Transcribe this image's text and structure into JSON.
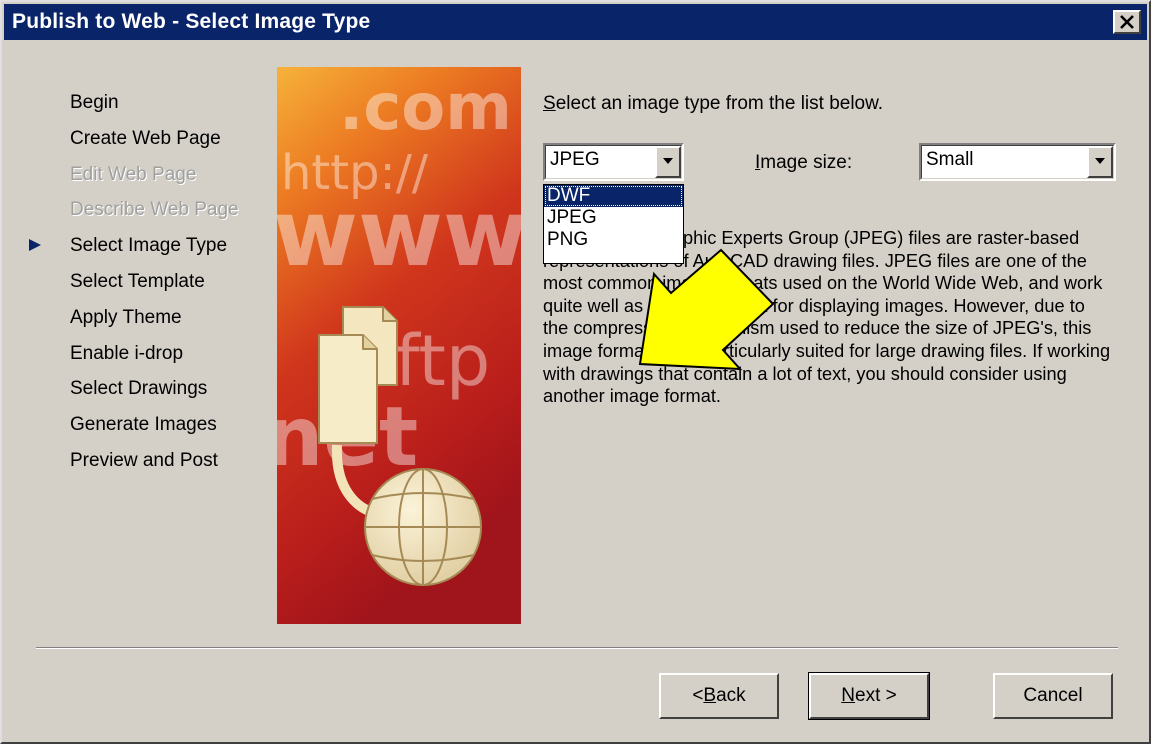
{
  "window": {
    "title": "Publish to Web - Select Image Type"
  },
  "steps": [
    {
      "label": "Begin",
      "state": "enabled"
    },
    {
      "label": "Create Web Page",
      "state": "enabled"
    },
    {
      "label": "Edit Web Page",
      "state": "disabled"
    },
    {
      "label": "Describe Web Page",
      "state": "disabled"
    },
    {
      "label": "Select Image Type",
      "state": "current"
    },
    {
      "label": "Select Template",
      "state": "enabled"
    },
    {
      "label": "Apply Theme",
      "state": "enabled"
    },
    {
      "label": "Enable i-drop",
      "state": "enabled"
    },
    {
      "label": "Select Drawings",
      "state": "enabled"
    },
    {
      "label": "Generate Images",
      "state": "enabled"
    },
    {
      "label": "Preview and Post",
      "state": "enabled"
    }
  ],
  "art": {
    "texts": [
      ".com",
      "http://",
      "www",
      "ftp",
      "net"
    ]
  },
  "instruction": {
    "mnemonic": "S",
    "rest": "elect an image type from the list below."
  },
  "image_type": {
    "value": "JPEG",
    "options": [
      "DWF",
      "JPEG",
      "PNG"
    ],
    "highlighted": "DWF"
  },
  "image_size": {
    "label_mnemonic": "I",
    "label_rest": "mage size:",
    "value": "Small"
  },
  "description_visible": "phic Experts Group (JPEG) files are raster-based representations of AutoCAD drawing files. JPEG files are one of the most common image formats used on the World Wide Web, and work quite well as a digital format for displaying images.  However, due to the compression mechanism used to reduce the size of JPEG's, this image format is not particularly suited for large drawing files.  If working with drawings that contain a lot of text, you should consider using another image format.",
  "buttons": {
    "back": {
      "prefix": "< ",
      "mnemonic": "B",
      "rest": "ack"
    },
    "next": {
      "mnemonic": "N",
      "rest": "ext >"
    },
    "cancel": {
      "label": "Cancel"
    }
  },
  "colors": {
    "title_bar": "#0a246a",
    "dialog_face": "#d4d0c8",
    "selection": "#0a246a",
    "pointer_arrow": "#ffff00",
    "step_marker": "#0a246a"
  },
  "icons": [
    "close-icon",
    "step-current-marker-icon",
    "dropdown-arrow-icon",
    "document-icon",
    "globe-icon",
    "pointer-arrow-icon"
  ]
}
